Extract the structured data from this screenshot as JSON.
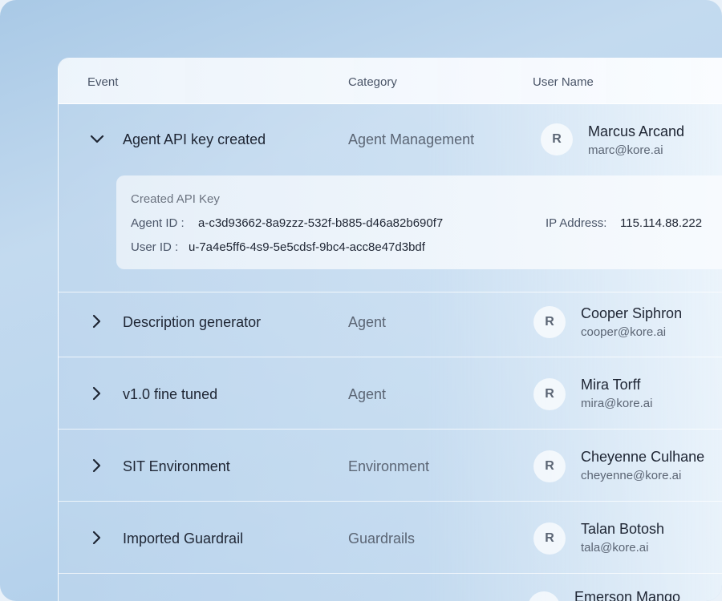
{
  "table": {
    "headers": {
      "event": "Event",
      "category": "Category",
      "user_name": "User Name"
    }
  },
  "expanded_row": {
    "event": "Agent API key created",
    "category": "Agent Management",
    "avatar": "R",
    "user_name": "Marcus Arcand",
    "user_email": "marc@kore.ai",
    "detail": {
      "title": "Created API Key",
      "agent_id_label": "Agent ID :",
      "agent_id": "a-c3d93662-8a9zzz-532f-b885-d46a82b690f7",
      "user_id_label": "User ID :",
      "user_id": "u-7a4e5ff6-4s9-5e5cdsf-9bc4-acc8e47d3bdf",
      "ip_label": "IP Address:",
      "ip": "115.114.88.222"
    }
  },
  "rows": [
    {
      "event": "Description generator",
      "category": "Agent",
      "avatar": "R",
      "user_name": "Cooper Siphron",
      "user_email": "cooper@kore.ai"
    },
    {
      "event": "v1.0 fine tuned",
      "category": "Agent",
      "avatar": "R",
      "user_name": "Mira Torff",
      "user_email": "mira@kore.ai"
    },
    {
      "event": "SIT Environment",
      "category": "Environment",
      "avatar": "R",
      "user_name": "Cheyenne Culhane",
      "user_email": "cheyenne@kore.ai"
    },
    {
      "event": "Imported Guardrail",
      "category": "Guardrails",
      "avatar": "R",
      "user_name": "Talan Botosh",
      "user_email": "tala@kore.ai"
    }
  ],
  "partial_row": {
    "user_name": "Emerson Mango"
  },
  "icons": {
    "expanded": "chevron-down-icon",
    "collapsed": "chevron-right-icon"
  }
}
